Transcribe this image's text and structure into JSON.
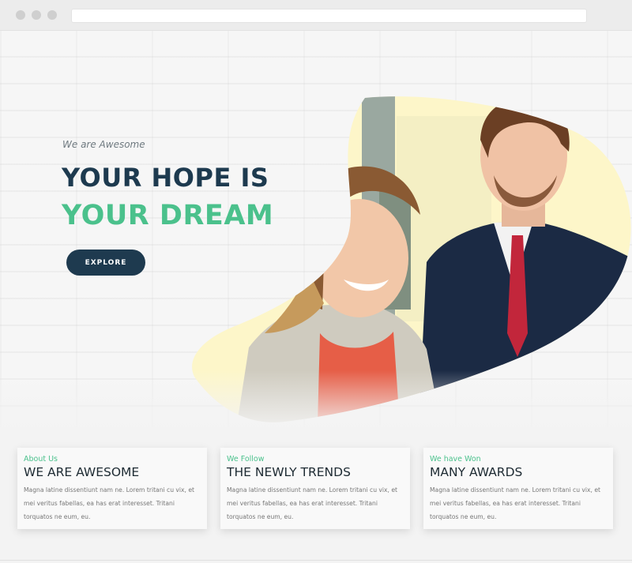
{
  "hero": {
    "eyebrow": "We are Awesome",
    "title_line1": "YOUR HOPE IS",
    "title_line2": "YOUR DREAM",
    "button_label": "EXPLORE"
  },
  "features": [
    {
      "kicker": "About Us",
      "title": "WE ARE AWESOME",
      "text": "Magna latine dissentiunt nam ne. Lorem tritani cu vix, et mei veritus fabellas, ea has erat interesset. Tritani torquatos ne eum, eu."
    },
    {
      "kicker": "We Follow",
      "title": "THE NEWLY TRENDS",
      "text": "Magna latine dissentiunt nam ne. Lorem tritani cu vix, et mei veritus fabellas, ea has erat interesset. Tritani torquatos ne eum, eu."
    },
    {
      "kicker": "We have Won",
      "title": "MANY AWARDS",
      "text": "Magna latine dissentiunt nam ne. Lorem tritani cu vix, et mei veritus fabellas, ea has erat interesset. Tritani torquatos ne eum, eu."
    }
  ],
  "colors": {
    "navy": "#1e3a4f",
    "green": "#4bc18c",
    "cream": "#fdf6c9"
  }
}
